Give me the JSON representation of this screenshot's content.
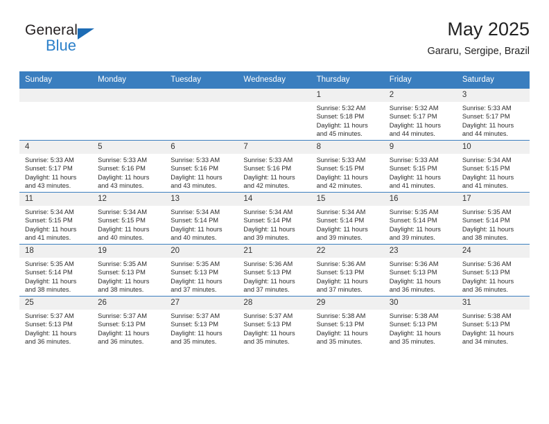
{
  "brand": {
    "name_part1": "General",
    "name_part2": "Blue",
    "triangle_icon": "blue-triangle-icon",
    "accent_color": "#2a7fc9"
  },
  "header": {
    "title": "May 2025",
    "subtitle": "Gararu, Sergipe, Brazil"
  },
  "calendar": {
    "header_color": "#3a7ebf",
    "daynum_bg": "#f0f0f0",
    "weekdays": [
      "Sunday",
      "Monday",
      "Tuesday",
      "Wednesday",
      "Thursday",
      "Friday",
      "Saturday"
    ],
    "weeks": [
      [
        {
          "day": "",
          "empty": true,
          "l1": "",
          "l2": "",
          "l3": "",
          "l4": ""
        },
        {
          "day": "",
          "empty": true,
          "l1": "",
          "l2": "",
          "l3": "",
          "l4": ""
        },
        {
          "day": "",
          "empty": true,
          "l1": "",
          "l2": "",
          "l3": "",
          "l4": ""
        },
        {
          "day": "",
          "empty": true,
          "l1": "",
          "l2": "",
          "l3": "",
          "l4": ""
        },
        {
          "day": "1",
          "empty": false,
          "l1": "Sunrise: 5:32 AM",
          "l2": "Sunset: 5:18 PM",
          "l3": "Daylight: 11 hours",
          "l4": "and 45 minutes."
        },
        {
          "day": "2",
          "empty": false,
          "l1": "Sunrise: 5:32 AM",
          "l2": "Sunset: 5:17 PM",
          "l3": "Daylight: 11 hours",
          "l4": "and 44 minutes."
        },
        {
          "day": "3",
          "empty": false,
          "l1": "Sunrise: 5:33 AM",
          "l2": "Sunset: 5:17 PM",
          "l3": "Daylight: 11 hours",
          "l4": "and 44 minutes."
        }
      ],
      [
        {
          "day": "4",
          "empty": false,
          "l1": "Sunrise: 5:33 AM",
          "l2": "Sunset: 5:17 PM",
          "l3": "Daylight: 11 hours",
          "l4": "and 43 minutes."
        },
        {
          "day": "5",
          "empty": false,
          "l1": "Sunrise: 5:33 AM",
          "l2": "Sunset: 5:16 PM",
          "l3": "Daylight: 11 hours",
          "l4": "and 43 minutes."
        },
        {
          "day": "6",
          "empty": false,
          "l1": "Sunrise: 5:33 AM",
          "l2": "Sunset: 5:16 PM",
          "l3": "Daylight: 11 hours",
          "l4": "and 43 minutes."
        },
        {
          "day": "7",
          "empty": false,
          "l1": "Sunrise: 5:33 AM",
          "l2": "Sunset: 5:16 PM",
          "l3": "Daylight: 11 hours",
          "l4": "and 42 minutes."
        },
        {
          "day": "8",
          "empty": false,
          "l1": "Sunrise: 5:33 AM",
          "l2": "Sunset: 5:15 PM",
          "l3": "Daylight: 11 hours",
          "l4": "and 42 minutes."
        },
        {
          "day": "9",
          "empty": false,
          "l1": "Sunrise: 5:33 AM",
          "l2": "Sunset: 5:15 PM",
          "l3": "Daylight: 11 hours",
          "l4": "and 41 minutes."
        },
        {
          "day": "10",
          "empty": false,
          "l1": "Sunrise: 5:34 AM",
          "l2": "Sunset: 5:15 PM",
          "l3": "Daylight: 11 hours",
          "l4": "and 41 minutes."
        }
      ],
      [
        {
          "day": "11",
          "empty": false,
          "l1": "Sunrise: 5:34 AM",
          "l2": "Sunset: 5:15 PM",
          "l3": "Daylight: 11 hours",
          "l4": "and 41 minutes."
        },
        {
          "day": "12",
          "empty": false,
          "l1": "Sunrise: 5:34 AM",
          "l2": "Sunset: 5:15 PM",
          "l3": "Daylight: 11 hours",
          "l4": "and 40 minutes."
        },
        {
          "day": "13",
          "empty": false,
          "l1": "Sunrise: 5:34 AM",
          "l2": "Sunset: 5:14 PM",
          "l3": "Daylight: 11 hours",
          "l4": "and 40 minutes."
        },
        {
          "day": "14",
          "empty": false,
          "l1": "Sunrise: 5:34 AM",
          "l2": "Sunset: 5:14 PM",
          "l3": "Daylight: 11 hours",
          "l4": "and 39 minutes."
        },
        {
          "day": "15",
          "empty": false,
          "l1": "Sunrise: 5:34 AM",
          "l2": "Sunset: 5:14 PM",
          "l3": "Daylight: 11 hours",
          "l4": "and 39 minutes."
        },
        {
          "day": "16",
          "empty": false,
          "l1": "Sunrise: 5:35 AM",
          "l2": "Sunset: 5:14 PM",
          "l3": "Daylight: 11 hours",
          "l4": "and 39 minutes."
        },
        {
          "day": "17",
          "empty": false,
          "l1": "Sunrise: 5:35 AM",
          "l2": "Sunset: 5:14 PM",
          "l3": "Daylight: 11 hours",
          "l4": "and 38 minutes."
        }
      ],
      [
        {
          "day": "18",
          "empty": false,
          "l1": "Sunrise: 5:35 AM",
          "l2": "Sunset: 5:14 PM",
          "l3": "Daylight: 11 hours",
          "l4": "and 38 minutes."
        },
        {
          "day": "19",
          "empty": false,
          "l1": "Sunrise: 5:35 AM",
          "l2": "Sunset: 5:13 PM",
          "l3": "Daylight: 11 hours",
          "l4": "and 38 minutes."
        },
        {
          "day": "20",
          "empty": false,
          "l1": "Sunrise: 5:35 AM",
          "l2": "Sunset: 5:13 PM",
          "l3": "Daylight: 11 hours",
          "l4": "and 37 minutes."
        },
        {
          "day": "21",
          "empty": false,
          "l1": "Sunrise: 5:36 AM",
          "l2": "Sunset: 5:13 PM",
          "l3": "Daylight: 11 hours",
          "l4": "and 37 minutes."
        },
        {
          "day": "22",
          "empty": false,
          "l1": "Sunrise: 5:36 AM",
          "l2": "Sunset: 5:13 PM",
          "l3": "Daylight: 11 hours",
          "l4": "and 37 minutes."
        },
        {
          "day": "23",
          "empty": false,
          "l1": "Sunrise: 5:36 AM",
          "l2": "Sunset: 5:13 PM",
          "l3": "Daylight: 11 hours",
          "l4": "and 36 minutes."
        },
        {
          "day": "24",
          "empty": false,
          "l1": "Sunrise: 5:36 AM",
          "l2": "Sunset: 5:13 PM",
          "l3": "Daylight: 11 hours",
          "l4": "and 36 minutes."
        }
      ],
      [
        {
          "day": "25",
          "empty": false,
          "l1": "Sunrise: 5:37 AM",
          "l2": "Sunset: 5:13 PM",
          "l3": "Daylight: 11 hours",
          "l4": "and 36 minutes."
        },
        {
          "day": "26",
          "empty": false,
          "l1": "Sunrise: 5:37 AM",
          "l2": "Sunset: 5:13 PM",
          "l3": "Daylight: 11 hours",
          "l4": "and 36 minutes."
        },
        {
          "day": "27",
          "empty": false,
          "l1": "Sunrise: 5:37 AM",
          "l2": "Sunset: 5:13 PM",
          "l3": "Daylight: 11 hours",
          "l4": "and 35 minutes."
        },
        {
          "day": "28",
          "empty": false,
          "l1": "Sunrise: 5:37 AM",
          "l2": "Sunset: 5:13 PM",
          "l3": "Daylight: 11 hours",
          "l4": "and 35 minutes."
        },
        {
          "day": "29",
          "empty": false,
          "l1": "Sunrise: 5:38 AM",
          "l2": "Sunset: 5:13 PM",
          "l3": "Daylight: 11 hours",
          "l4": "and 35 minutes."
        },
        {
          "day": "30",
          "empty": false,
          "l1": "Sunrise: 5:38 AM",
          "l2": "Sunset: 5:13 PM",
          "l3": "Daylight: 11 hours",
          "l4": "and 35 minutes."
        },
        {
          "day": "31",
          "empty": false,
          "l1": "Sunrise: 5:38 AM",
          "l2": "Sunset: 5:13 PM",
          "l3": "Daylight: 11 hours",
          "l4": "and 34 minutes."
        }
      ]
    ]
  }
}
